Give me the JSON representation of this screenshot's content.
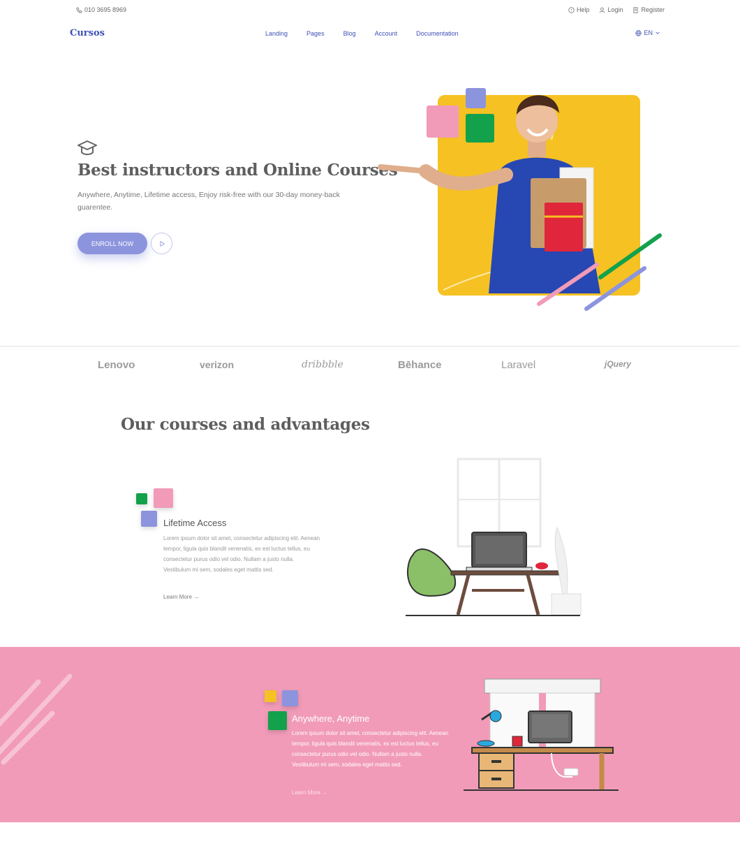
{
  "topbar": {
    "phone": "010 3695 8969",
    "links": [
      {
        "label": "Help",
        "icon": "help-icon"
      },
      {
        "label": "Login",
        "icon": "user-icon"
      },
      {
        "label": "Register",
        "icon": "register-icon"
      }
    ]
  },
  "nav": {
    "logo": "Cursos",
    "menu": [
      "Landing",
      "Pages",
      "Blog",
      "Account",
      "Documentation"
    ],
    "language": "EN"
  },
  "hero": {
    "title": "Best instructors and Online Courses",
    "subtitle": "Anywhere, Anytime, Lifetime access, Enjoy risk-free with our 30-day money-back guarentee.",
    "cta_label": "ENROLL NOW",
    "accent_color": "#8c94dd",
    "panel_color": "#f6c123"
  },
  "partners": [
    "Lenovo",
    "verizon",
    "dribbble",
    "Bēhance",
    "Laravel",
    "jQuery"
  ],
  "advantages": {
    "title": "Our courses and advantages",
    "features": [
      {
        "title": "Lifetime Access",
        "body": "Lorem ipsum dolor sit amet, consectetur adipiscing elit. Aenean tempor, ligula quis blandit venenatis, ex est luctus tellus, eu consectetur purus odio vel odio. Nullam a justo nulla. Vestibulum mi sem, sodales eget mattis sed.",
        "link": "Learn More →"
      },
      {
        "title": "Anywhere, Anytime",
        "body": "Lorem ipsum dolor sit amet, consectetur adipiscing elit. Aenean tempor, ligula quis blandit venenatis, ex est luctus tellus, eu consectetur purus odio vel odio. Nullam a justo nulla. Vestibulum mi sem, sodales eget mattis sed.",
        "link": "Learn More →"
      }
    ],
    "pink_color": "#f19bb8"
  }
}
